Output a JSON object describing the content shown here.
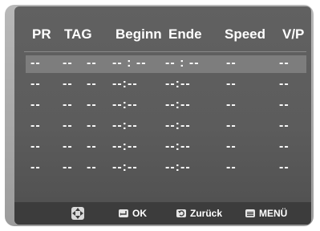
{
  "columns": {
    "pr": "PR",
    "tag": "TAG",
    "beginn": "Beginn",
    "ende": "Ende",
    "speed": "Speed",
    "vp": "V/P"
  },
  "rows": [
    {
      "pr": "--",
      "day": "--",
      "wk": "--",
      "beginn": "-- : --",
      "ende": "-- : --",
      "speed": "--",
      "vp": "--"
    },
    {
      "pr": "--",
      "day": "--",
      "wk": "--",
      "beginn": "--:--",
      "ende": "--:--",
      "speed": "--",
      "vp": "--"
    },
    {
      "pr": "--",
      "day": "--",
      "wk": "--",
      "beginn": "--:--",
      "ende": "--:--",
      "speed": "--",
      "vp": "--"
    },
    {
      "pr": "--",
      "day": "--",
      "wk": "--",
      "beginn": "--:--",
      "ende": "--:--",
      "speed": "--",
      "vp": "--"
    },
    {
      "pr": "--",
      "day": "--",
      "wk": "--",
      "beginn": "--:--",
      "ende": "--:--",
      "speed": "--",
      "vp": "--"
    },
    {
      "pr": "--",
      "day": "--",
      "wk": "--",
      "beginn": "--:--",
      "ende": "--:--",
      "speed": "--",
      "vp": "--"
    }
  ],
  "footer": {
    "nav_icon": "dpad-icon",
    "ok_label": "OK",
    "back_label": "Zurück",
    "menu_label": "MENÜ"
  },
  "colors": {
    "screen": "#5c5c5c",
    "selected_row": "#7d7d7d",
    "footer": "#3c3c3c",
    "text": "#ffffff"
  }
}
